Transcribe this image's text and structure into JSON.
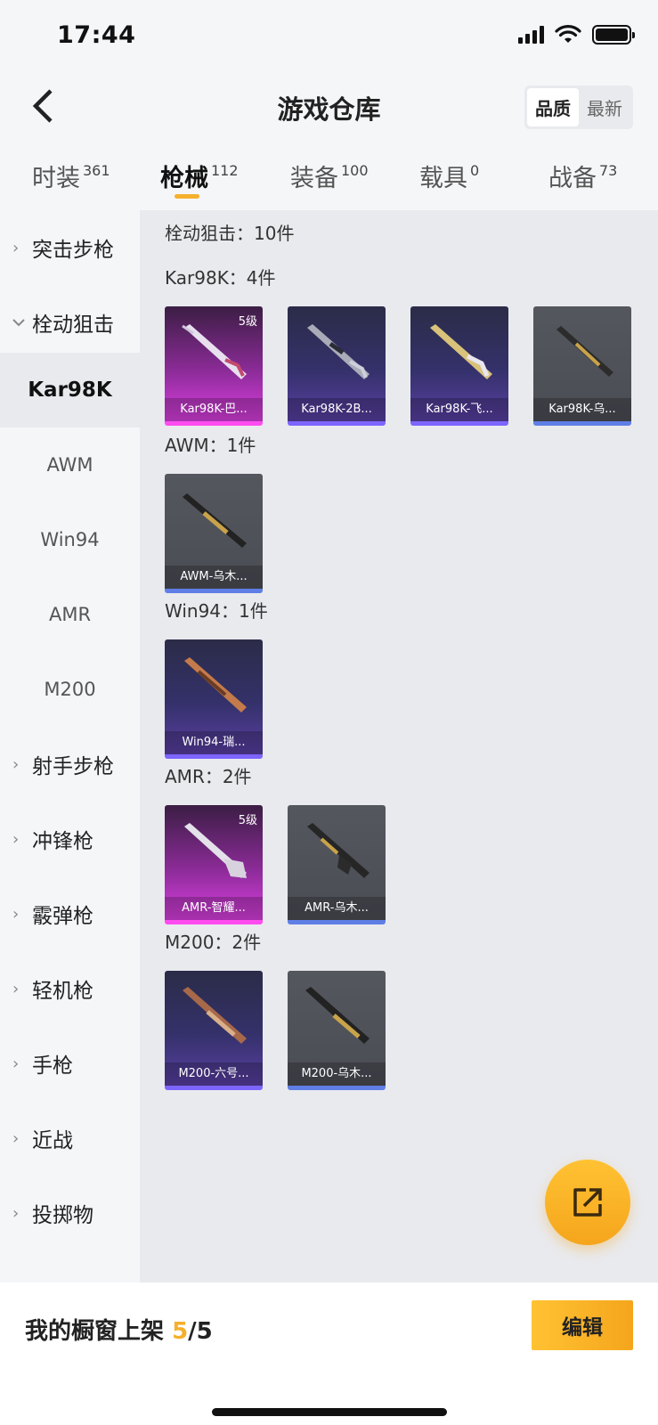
{
  "status_bar": {
    "time": "17:44"
  },
  "header": {
    "title": "游戏仓库",
    "sort_options": [
      "品质",
      "最新"
    ],
    "sort_selected": "品质"
  },
  "tabs": [
    {
      "label": "时装",
      "count": "361"
    },
    {
      "label": "枪械",
      "count": "112",
      "active": true
    },
    {
      "label": "装备",
      "count": "100"
    },
    {
      "label": "载具",
      "count": "0"
    },
    {
      "label": "战备",
      "count": "73"
    }
  ],
  "sidebar": {
    "categories_top": [
      {
        "label": "突击步枪",
        "expanded": false
      },
      {
        "label": "栓动狙击",
        "expanded": true
      }
    ],
    "subitems": [
      "Kar98K",
      "AWM",
      "Win94",
      "AMR",
      "M200"
    ],
    "subitem_selected": "Kar98K",
    "categories_bottom": [
      "射手步枪",
      "冲锋枪",
      "霰弹枪",
      "轻机枪",
      "手枪",
      "近战",
      "投掷物"
    ]
  },
  "content": {
    "summary": "栓动狙击：10件",
    "groups": [
      {
        "title": "Kar98K：4件",
        "items": [
          {
            "name": "Kar98K-巴...",
            "level": "5级",
            "rarity": "pink"
          },
          {
            "name": "Kar98K-2B...",
            "rarity": "purple"
          },
          {
            "name": "Kar98K-飞...",
            "rarity": "purple"
          },
          {
            "name": "Kar98K-乌...",
            "rarity": "gray"
          }
        ]
      },
      {
        "title": "AWM：1件",
        "items": [
          {
            "name": "AWM-乌木...",
            "rarity": "gray"
          }
        ]
      },
      {
        "title": "Win94：1件",
        "items": [
          {
            "name": "Win94-瑞...",
            "rarity": "purple"
          }
        ]
      },
      {
        "title": "AMR：2件",
        "items": [
          {
            "name": "AMR-智耀...",
            "level": "5级",
            "rarity": "pink"
          },
          {
            "name": "AMR-乌木...",
            "rarity": "gray"
          }
        ]
      },
      {
        "title": "M200：2件",
        "items": [
          {
            "name": "M200-六号...",
            "rarity": "purple"
          },
          {
            "name": "M200-乌木...",
            "rarity": "gray"
          }
        ]
      }
    ]
  },
  "bottom_bar": {
    "shelf_label": "我的橱窗上架",
    "shelf_current": "5",
    "shelf_total": "/5",
    "edit_label": "编辑"
  },
  "colors": {
    "accent": "#f5b02c",
    "rarity_pink": "#ff4cf0",
    "rarity_purple": "#7d65ff",
    "rarity_gray": "#5f7fe6"
  },
  "icons": {
    "back": "chevron-left-icon",
    "share": "external-link-icon",
    "expand": "chevron-right-icon",
    "collapse": "chevron-down-icon"
  }
}
